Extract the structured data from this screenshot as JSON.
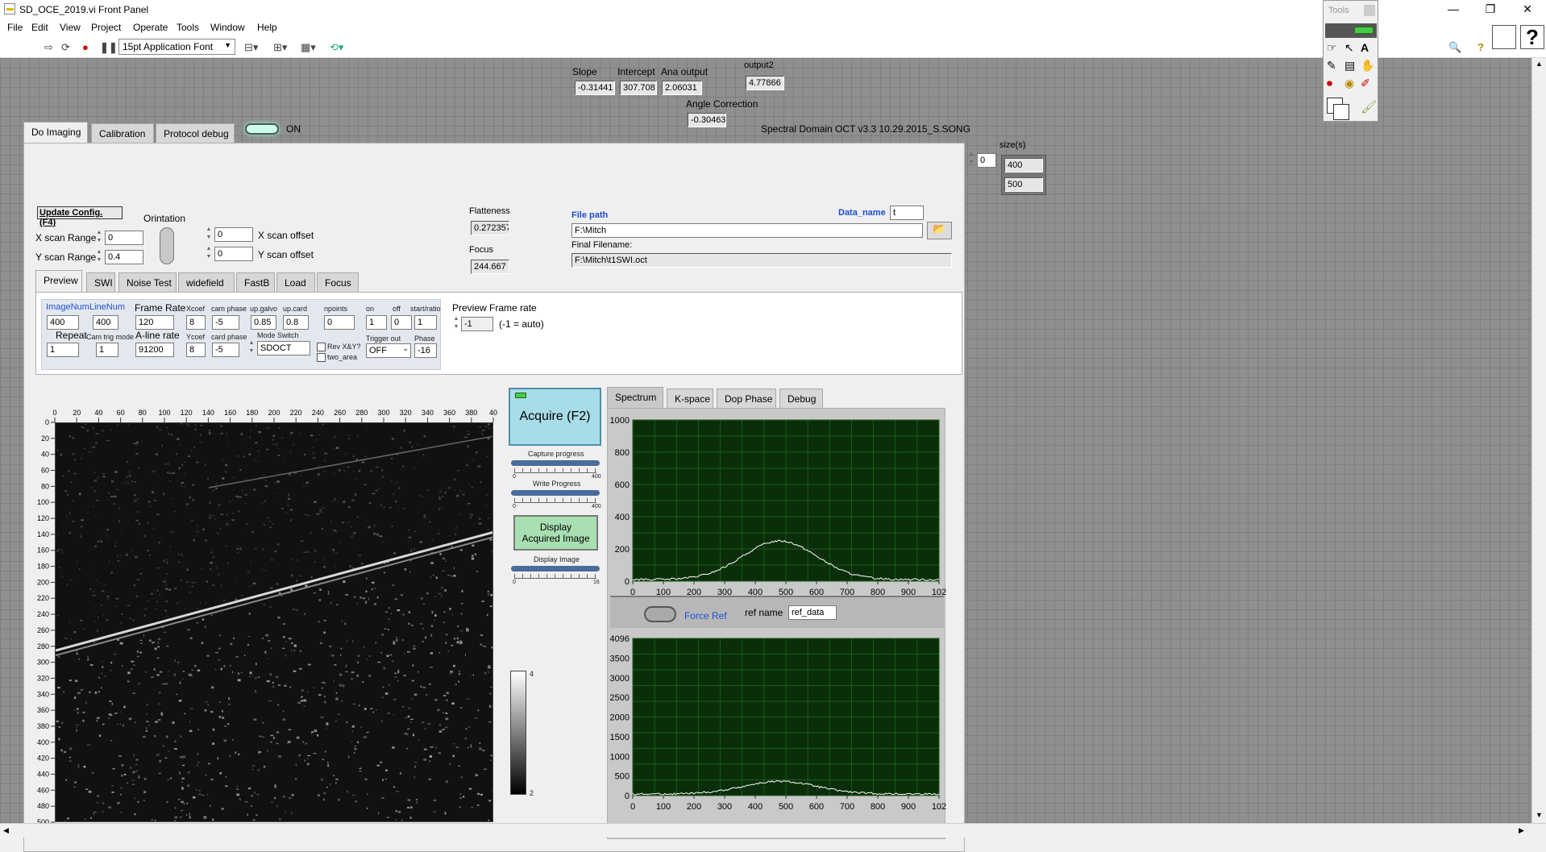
{
  "window": {
    "title": "SD_OCE_2019.vi Front Panel",
    "minimize": "—",
    "maximize": "❐",
    "close": "✕"
  },
  "menu": [
    "File",
    "Edit",
    "View",
    "Project",
    "Operate",
    "Tools",
    "Window",
    "Help"
  ],
  "toolbar": {
    "font": "15pt Application Font",
    "search_placeholder": "rch",
    "help": "?"
  },
  "tools_palette": {
    "title": "Tools",
    "help": "?"
  },
  "top_indicators": {
    "slope_label": "Slope",
    "slope": "-0.31441",
    "intercept_label": "Intercept",
    "intercept": "307.708",
    "ana_label": "Ana output",
    "ana": "2.06031",
    "output2_label": "output2",
    "output2": "4.77866",
    "angle_label": "Angle Correction",
    "angle": "-0.30463"
  },
  "version_text": "Spectral Domain OCT v3.3  10.29.2015_S.SONG",
  "main_tabs": [
    "Do Imaging",
    "Calibration",
    "Protocol debug"
  ],
  "on_switch": "ON",
  "config": {
    "update_button": "Update Config. (F4)",
    "orientation_label": "Orintation",
    "x_range_label": "X scan Range",
    "x_range": "0",
    "y_range_label": "Y scan Range",
    "y_range": "0.4",
    "x_offset_label": "X scan offset",
    "x_offset": "0",
    "y_offset_label": "Y scan offset",
    "y_offset": "0",
    "flatness_label": "Flatteness",
    "flatness": "0.272357",
    "focus_label": "Focus",
    "focus": "244.667",
    "file_path_label": "File path",
    "file_path": "F:\\Mitch",
    "final_label": "Final Filename:",
    "final": "F:\\Mitch\\t1SWI.oct",
    "data_name_label": "Data_name",
    "data_name": "t"
  },
  "size_array": {
    "index": "0",
    "label": "size(s)",
    "values": [
      "400",
      "500"
    ]
  },
  "sub_tabs": [
    "Preview",
    "SWI",
    "Noise Test",
    "widefield",
    "FastB",
    "Load",
    "Focus"
  ],
  "preview": {
    "imagenum_label": "ImageNum",
    "imagenum": "400",
    "linenum_label": "LineNum",
    "linenum": "400",
    "framerate_label": "Frame Rate",
    "framerate": "120",
    "xcoef_label": "Xcoef",
    "xcoef": "8",
    "camphase_label": "cam phase",
    "camphase": "-5",
    "upgalvo_label": "up.galvo",
    "upgalvo": "0.85",
    "upcard_label": "up.card",
    "upcard": "0.8",
    "npoints_label": "npoints",
    "npoints": "0",
    "on_label": "on",
    "on": "1",
    "off_label": "off",
    "off": "0",
    "start_label": "start/ratio",
    "start": "1",
    "repeat_label": "Repeat",
    "repeat": "1",
    "camtrig_label": "Cam trig mode",
    "camtrig": "1",
    "aline_label": "A-line rate",
    "aline": "91200",
    "ycoef_label": "Ycoef",
    "ycoef": "8",
    "cardphase_label": "card phase",
    "cardphase": "-5",
    "mode_label": "Mode Switch",
    "mode": "SDOCT",
    "revxy_label": "Rev X&Y?",
    "twoarea_label": "two_area",
    "trigger_label": "Trigger out",
    "trigger": "OFF",
    "phase_label": "Phase",
    "phase": "-16",
    "pfr_label": "Preview Frame rate",
    "pfr": "-1",
    "pfr_note": "(-1 = auto)"
  },
  "image": {
    "x_ticks": [
      "0",
      "20",
      "40",
      "60",
      "80",
      "100",
      "120",
      "140",
      "160",
      "180",
      "200",
      "220",
      "240",
      "260",
      "280",
      "300",
      "320",
      "340",
      "360",
      "380",
      "40"
    ],
    "y_ticks": [
      "0",
      "20",
      "40",
      "60",
      "80",
      "100",
      "120",
      "140",
      "160",
      "180",
      "200",
      "220",
      "240",
      "260",
      "280",
      "300",
      "320",
      "340",
      "360",
      "380",
      "400",
      "420",
      "440",
      "460",
      "480",
      "500"
    ],
    "colorbar_max": "4",
    "colorbar_min": "2"
  },
  "acquire": {
    "button": "Acquire (F2)",
    "capture_label": "Capture progress",
    "write_label": "Write Progress",
    "display_button_line1": "Display",
    "display_button_line2": "Acquired Image",
    "display_label": "Display Image",
    "scale_min": "0",
    "scale_max1": "400",
    "scale_max2": "400",
    "scale_max3": "16"
  },
  "graph_tabs": [
    "Spectrum",
    "K-space",
    "Dop Phase",
    "Debug"
  ],
  "spectrum": {
    "y_ticks": [
      "1000",
      "800",
      "600",
      "400",
      "200",
      "0"
    ],
    "x_ticks": [
      "0",
      "100",
      "200",
      "300",
      "400",
      "500",
      "600",
      "700",
      "800",
      "900",
      "102"
    ]
  },
  "reference": {
    "force_label": "Force Ref",
    "ref_label": "ref name",
    "ref": "ref_data",
    "y_ticks": [
      "4096",
      "3500",
      "3000",
      "2500",
      "2000",
      "1500",
      "1000",
      "500",
      "0"
    ],
    "x_ticks": [
      "0",
      "100",
      "200",
      "300",
      "400",
      "500",
      "600",
      "700",
      "800",
      "900",
      "102"
    ]
  },
  "colors": {
    "canvas": "#8f8f8f",
    "graph_bg": "#0a2e0a",
    "grid": "#1f6e1f",
    "label_blue": "#1f4fd0",
    "acquire_bg": "#a8dce8"
  }
}
